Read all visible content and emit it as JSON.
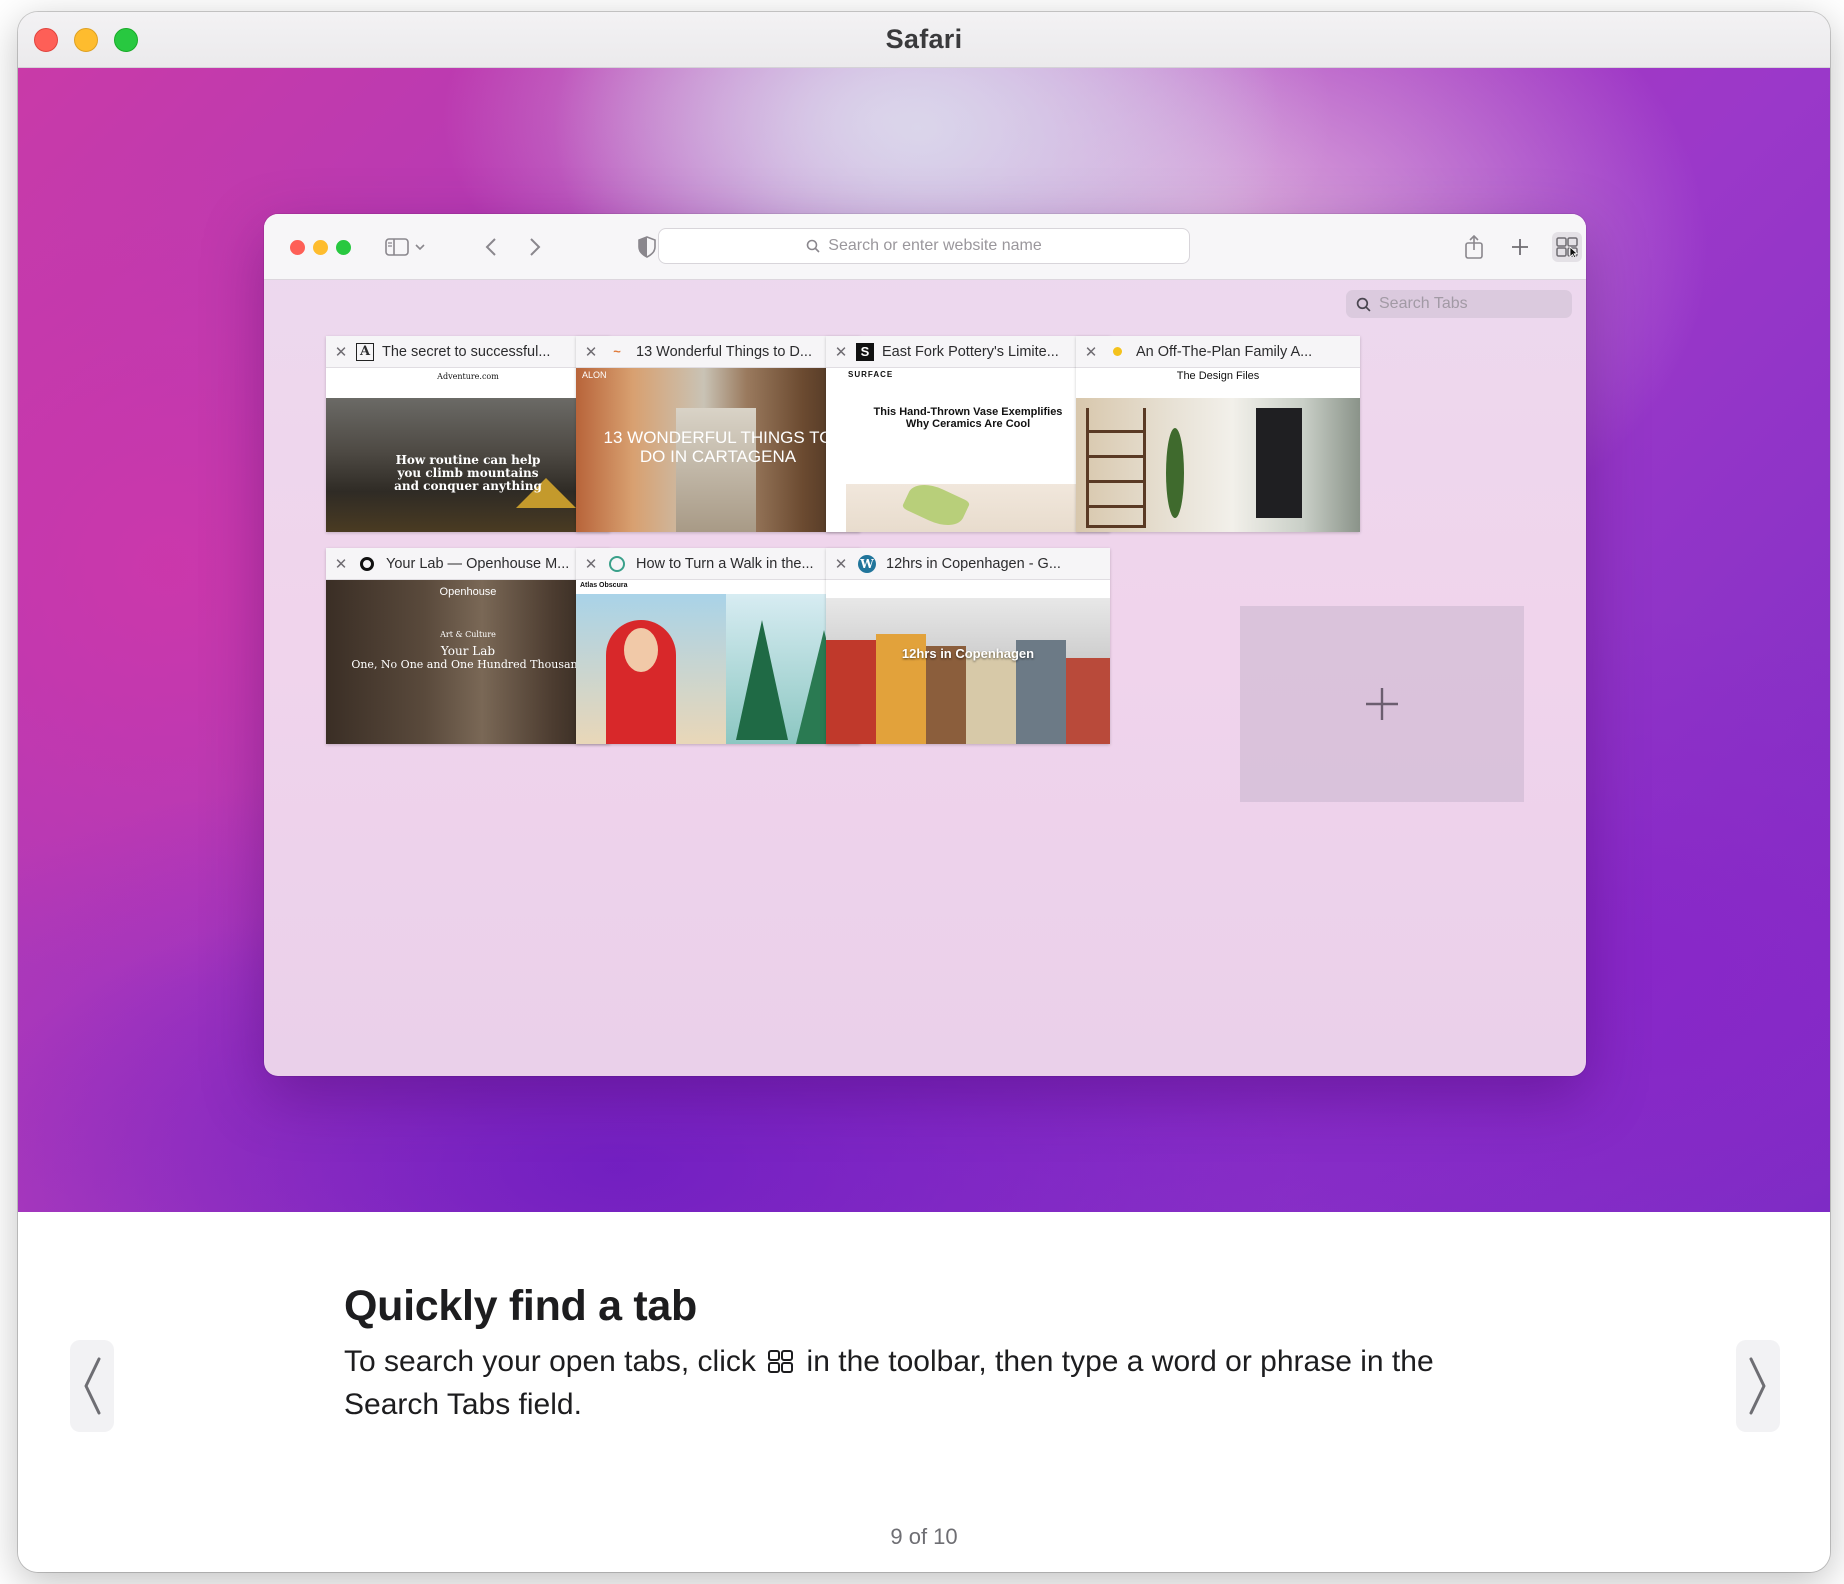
{
  "window": {
    "title": "Safari"
  },
  "browser": {
    "address_placeholder": "Search or enter website name",
    "search_tabs_placeholder": "Search Tabs",
    "tabs": [
      {
        "title": "The secret to successful...",
        "favicon": "A",
        "thumb_text": "How routine can help you climb mountains and conquer anything",
        "site_name": "Adventure.com"
      },
      {
        "title": "13 Wonderful Things to D...",
        "favicon": "~",
        "thumb_text": "13 WONDERFUL THINGS TO DO IN CARTAGENA",
        "site_name": "ALON"
      },
      {
        "title": "East Fork Pottery's Limite...",
        "favicon": "S",
        "thumb_text": "This Hand-Thrown Vase Exemplifies Why Ceramics Are Cool",
        "site_name": "SURFACE"
      },
      {
        "title": "An Off-The-Plan Family A...",
        "favicon": "dot",
        "thumb_text": "",
        "site_name": "The Design Files"
      },
      {
        "title": "Your Lab — Openhouse M...",
        "favicon": "O",
        "thumb_text": "Your Lab",
        "thumb_subtext": "One, No One and One Hundred Thousand",
        "site_name": "Openhouse",
        "kicker": "Art & Culture"
      },
      {
        "title": "How to Turn a Walk in the...",
        "favicon": "AO",
        "thumb_text": "",
        "site_name": "Atlas Obscura"
      },
      {
        "title": "12hrs in Copenhagen - G...",
        "favicon": "W",
        "thumb_text": "12hrs in Copenhagen",
        "site_name": ""
      }
    ]
  },
  "content": {
    "heading": "Quickly find a tab",
    "body_before": "To search your open tabs, click",
    "body_after": "in the toolbar, then type a word or phrase in the Search Tabs field.",
    "page_counter": "9 of 10"
  },
  "colors": {
    "accent_red": "#fe5f57",
    "accent_yellow": "#febc2e",
    "accent_green": "#28c840"
  }
}
